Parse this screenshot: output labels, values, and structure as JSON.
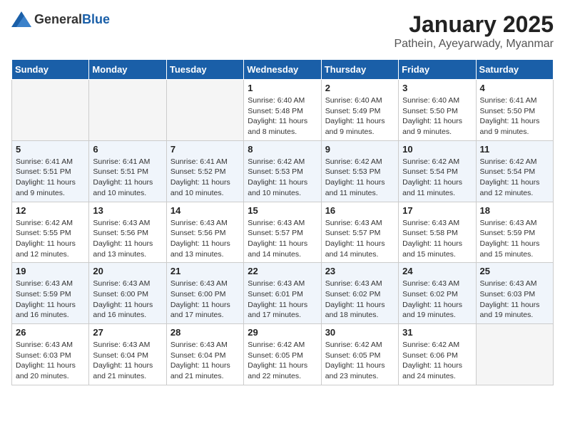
{
  "header": {
    "logo_general": "General",
    "logo_blue": "Blue",
    "title": "January 2025",
    "subtitle": "Pathein, Ayeyarwady, Myanmar"
  },
  "days_of_week": [
    "Sunday",
    "Monday",
    "Tuesday",
    "Wednesday",
    "Thursday",
    "Friday",
    "Saturday"
  ],
  "weeks": [
    {
      "days": [
        {
          "number": "",
          "info": "",
          "empty": true
        },
        {
          "number": "",
          "info": "",
          "empty": true
        },
        {
          "number": "",
          "info": "",
          "empty": true
        },
        {
          "number": "1",
          "info": "Sunrise: 6:40 AM\nSunset: 5:48 PM\nDaylight: 11 hours and 8 minutes.",
          "empty": false
        },
        {
          "number": "2",
          "info": "Sunrise: 6:40 AM\nSunset: 5:49 PM\nDaylight: 11 hours and 9 minutes.",
          "empty": false
        },
        {
          "number": "3",
          "info": "Sunrise: 6:40 AM\nSunset: 5:50 PM\nDaylight: 11 hours and 9 minutes.",
          "empty": false
        },
        {
          "number": "4",
          "info": "Sunrise: 6:41 AM\nSunset: 5:50 PM\nDaylight: 11 hours and 9 minutes.",
          "empty": false
        }
      ]
    },
    {
      "days": [
        {
          "number": "5",
          "info": "Sunrise: 6:41 AM\nSunset: 5:51 PM\nDaylight: 11 hours and 9 minutes.",
          "empty": false
        },
        {
          "number": "6",
          "info": "Sunrise: 6:41 AM\nSunset: 5:51 PM\nDaylight: 11 hours and 10 minutes.",
          "empty": false
        },
        {
          "number": "7",
          "info": "Sunrise: 6:41 AM\nSunset: 5:52 PM\nDaylight: 11 hours and 10 minutes.",
          "empty": false
        },
        {
          "number": "8",
          "info": "Sunrise: 6:42 AM\nSunset: 5:53 PM\nDaylight: 11 hours and 10 minutes.",
          "empty": false
        },
        {
          "number": "9",
          "info": "Sunrise: 6:42 AM\nSunset: 5:53 PM\nDaylight: 11 hours and 11 minutes.",
          "empty": false
        },
        {
          "number": "10",
          "info": "Sunrise: 6:42 AM\nSunset: 5:54 PM\nDaylight: 11 hours and 11 minutes.",
          "empty": false
        },
        {
          "number": "11",
          "info": "Sunrise: 6:42 AM\nSunset: 5:54 PM\nDaylight: 11 hours and 12 minutes.",
          "empty": false
        }
      ]
    },
    {
      "days": [
        {
          "number": "12",
          "info": "Sunrise: 6:42 AM\nSunset: 5:55 PM\nDaylight: 11 hours and 12 minutes.",
          "empty": false
        },
        {
          "number": "13",
          "info": "Sunrise: 6:43 AM\nSunset: 5:56 PM\nDaylight: 11 hours and 13 minutes.",
          "empty": false
        },
        {
          "number": "14",
          "info": "Sunrise: 6:43 AM\nSunset: 5:56 PM\nDaylight: 11 hours and 13 minutes.",
          "empty": false
        },
        {
          "number": "15",
          "info": "Sunrise: 6:43 AM\nSunset: 5:57 PM\nDaylight: 11 hours and 14 minutes.",
          "empty": false
        },
        {
          "number": "16",
          "info": "Sunrise: 6:43 AM\nSunset: 5:57 PM\nDaylight: 11 hours and 14 minutes.",
          "empty": false
        },
        {
          "number": "17",
          "info": "Sunrise: 6:43 AM\nSunset: 5:58 PM\nDaylight: 11 hours and 15 minutes.",
          "empty": false
        },
        {
          "number": "18",
          "info": "Sunrise: 6:43 AM\nSunset: 5:59 PM\nDaylight: 11 hours and 15 minutes.",
          "empty": false
        }
      ]
    },
    {
      "days": [
        {
          "number": "19",
          "info": "Sunrise: 6:43 AM\nSunset: 5:59 PM\nDaylight: 11 hours and 16 minutes.",
          "empty": false
        },
        {
          "number": "20",
          "info": "Sunrise: 6:43 AM\nSunset: 6:00 PM\nDaylight: 11 hours and 16 minutes.",
          "empty": false
        },
        {
          "number": "21",
          "info": "Sunrise: 6:43 AM\nSunset: 6:00 PM\nDaylight: 11 hours and 17 minutes.",
          "empty": false
        },
        {
          "number": "22",
          "info": "Sunrise: 6:43 AM\nSunset: 6:01 PM\nDaylight: 11 hours and 17 minutes.",
          "empty": false
        },
        {
          "number": "23",
          "info": "Sunrise: 6:43 AM\nSunset: 6:02 PM\nDaylight: 11 hours and 18 minutes.",
          "empty": false
        },
        {
          "number": "24",
          "info": "Sunrise: 6:43 AM\nSunset: 6:02 PM\nDaylight: 11 hours and 19 minutes.",
          "empty": false
        },
        {
          "number": "25",
          "info": "Sunrise: 6:43 AM\nSunset: 6:03 PM\nDaylight: 11 hours and 19 minutes.",
          "empty": false
        }
      ]
    },
    {
      "days": [
        {
          "number": "26",
          "info": "Sunrise: 6:43 AM\nSunset: 6:03 PM\nDaylight: 11 hours and 20 minutes.",
          "empty": false
        },
        {
          "number": "27",
          "info": "Sunrise: 6:43 AM\nSunset: 6:04 PM\nDaylight: 11 hours and 21 minutes.",
          "empty": false
        },
        {
          "number": "28",
          "info": "Sunrise: 6:43 AM\nSunset: 6:04 PM\nDaylight: 11 hours and 21 minutes.",
          "empty": false
        },
        {
          "number": "29",
          "info": "Sunrise: 6:42 AM\nSunset: 6:05 PM\nDaylight: 11 hours and 22 minutes.",
          "empty": false
        },
        {
          "number": "30",
          "info": "Sunrise: 6:42 AM\nSunset: 6:05 PM\nDaylight: 11 hours and 23 minutes.",
          "empty": false
        },
        {
          "number": "31",
          "info": "Sunrise: 6:42 AM\nSunset: 6:06 PM\nDaylight: 11 hours and 24 minutes.",
          "empty": false
        },
        {
          "number": "",
          "info": "",
          "empty": true
        }
      ]
    }
  ]
}
